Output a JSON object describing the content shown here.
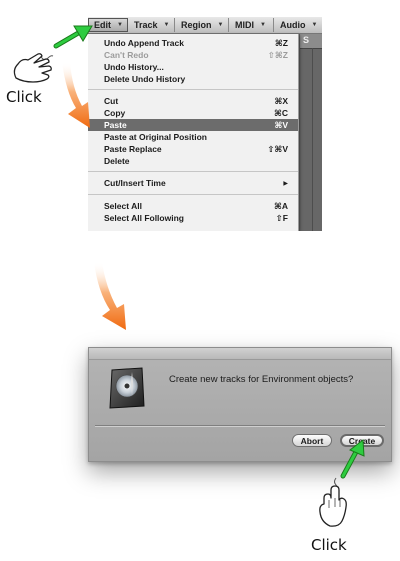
{
  "menubar": {
    "items": [
      {
        "label": "Edit",
        "active": true
      },
      {
        "label": "Track",
        "active": false
      },
      {
        "label": "Region",
        "active": false
      },
      {
        "label": "MIDI",
        "active": false
      },
      {
        "label": "Audio",
        "active": false
      }
    ],
    "track_area_letter": "S"
  },
  "edit_menu": {
    "items": [
      {
        "label": "Undo Append Track",
        "shortcut": "⌘Z",
        "state": "enabled"
      },
      {
        "label": "Can't Redo",
        "shortcut": "⇧⌘Z",
        "state": "disabled"
      },
      {
        "label": "Undo History...",
        "shortcut": "",
        "state": "enabled"
      },
      {
        "label": "Delete Undo History",
        "shortcut": "",
        "state": "enabled"
      },
      {
        "label": "Cut",
        "shortcut": "⌘X",
        "state": "enabled"
      },
      {
        "label": "Copy",
        "shortcut": "⌘C",
        "state": "enabled"
      },
      {
        "label": "Paste",
        "shortcut": "⌘V",
        "state": "highlighted"
      },
      {
        "label": "Paste at Original Position",
        "shortcut": "",
        "state": "enabled"
      },
      {
        "label": "Paste Replace",
        "shortcut": "⇧⌘V",
        "state": "enabled"
      },
      {
        "label": "Delete",
        "shortcut": "",
        "state": "enabled"
      },
      {
        "label": "Cut/Insert Time",
        "shortcut": "▶",
        "state": "enabled"
      },
      {
        "label": "Select All",
        "shortcut": "⌘A",
        "state": "enabled"
      },
      {
        "label": "Select All Following",
        "shortcut": "⇧F",
        "state": "enabled"
      }
    ]
  },
  "dialog": {
    "message": "Create new tracks for Environment objects?",
    "abort_label": "Abort",
    "create_label": "Create",
    "icon": "logic-app-icon"
  },
  "callouts": {
    "top_label": "Click",
    "bottom_label": "Click"
  },
  "colors": {
    "highlight": "#6c6c6c",
    "arrow_green": "#2ecc40",
    "arrow_orange": "#f07a1c"
  }
}
